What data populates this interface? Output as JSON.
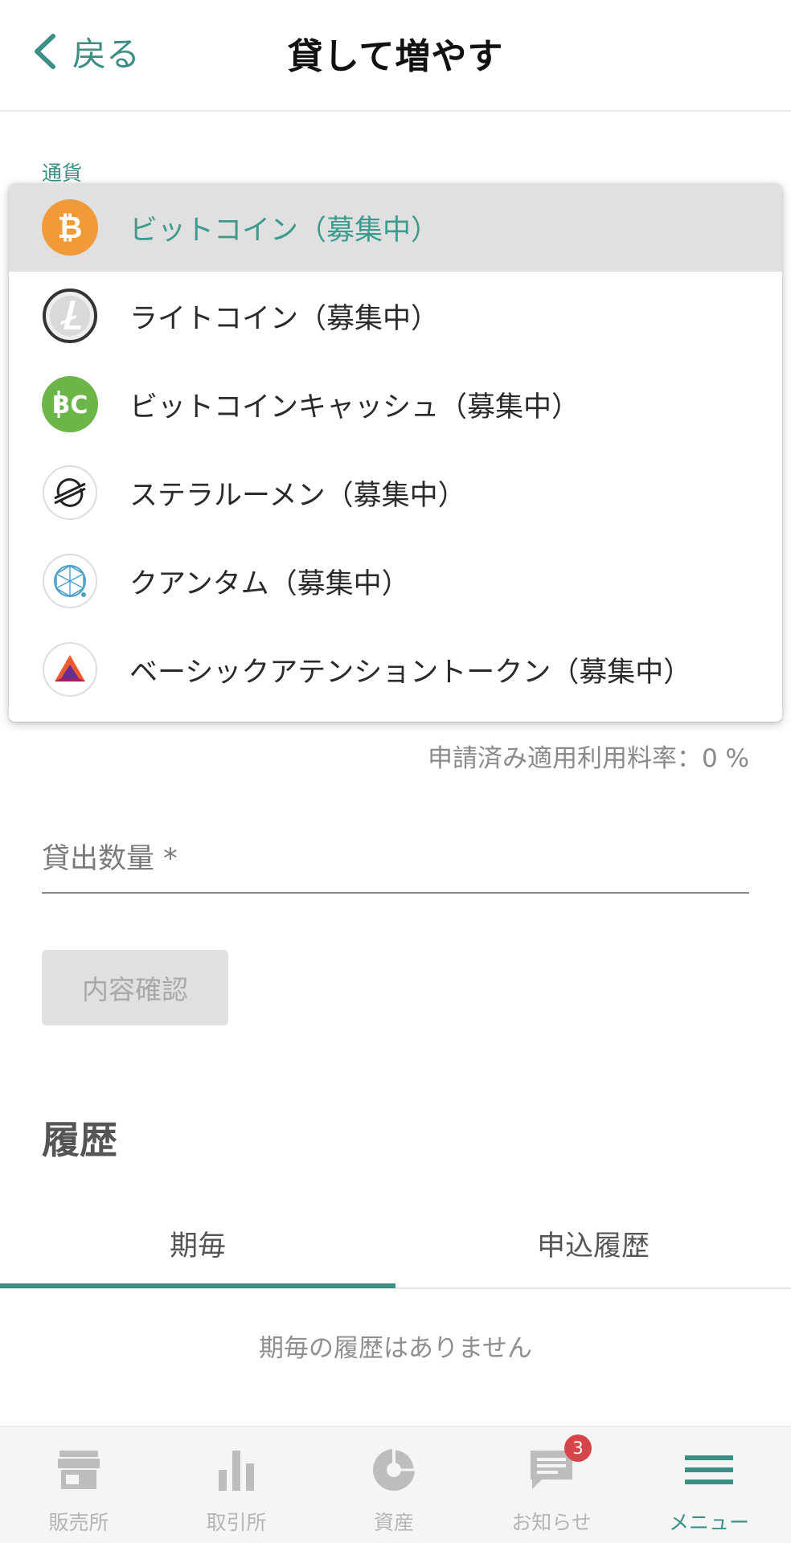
{
  "header": {
    "back_label": "戻る",
    "title": "貸して増やす"
  },
  "form": {
    "currency_label": "通貨",
    "rate_text": "申請済み適用利用料率：0 %",
    "amount_label": "貸出数量 *",
    "confirm_button": "内容確認"
  },
  "dropdown": {
    "options": [
      {
        "label": "ビットコイン（募集中）",
        "icon": "bitcoin-icon",
        "selected": true
      },
      {
        "label": "ライトコイン（募集中）",
        "icon": "litecoin-icon",
        "selected": false
      },
      {
        "label": "ビットコインキャッシュ（募集中）",
        "icon": "bitcoin-cash-icon",
        "selected": false
      },
      {
        "label": "ステラルーメン（募集中）",
        "icon": "stellar-icon",
        "selected": false
      },
      {
        "label": "クアンタム（募集中）",
        "icon": "qtum-icon",
        "selected": false
      },
      {
        "label": "ベーシックアテンショントークン（募集中）",
        "icon": "bat-icon",
        "selected": false
      }
    ]
  },
  "history": {
    "title": "履歴",
    "tabs": [
      {
        "label": "期毎",
        "active": true
      },
      {
        "label": "申込履歴",
        "active": false
      }
    ],
    "empty_text": "期毎の履歴はありません"
  },
  "bottom_nav": {
    "items": [
      {
        "label": "販売所",
        "icon": "store-icon"
      },
      {
        "label": "取引所",
        "icon": "bar-chart-icon"
      },
      {
        "label": "資産",
        "icon": "pie-chart-icon"
      },
      {
        "label": "お知らせ",
        "icon": "message-icon",
        "badge": "3"
      },
      {
        "label": "メニュー",
        "icon": "menu-icon",
        "active": true
      }
    ]
  },
  "colors": {
    "accent": "#3d8f86",
    "bitcoin": "#f09a3a",
    "bitcoin_cash": "#6cb548",
    "badge": "#d6454a"
  }
}
